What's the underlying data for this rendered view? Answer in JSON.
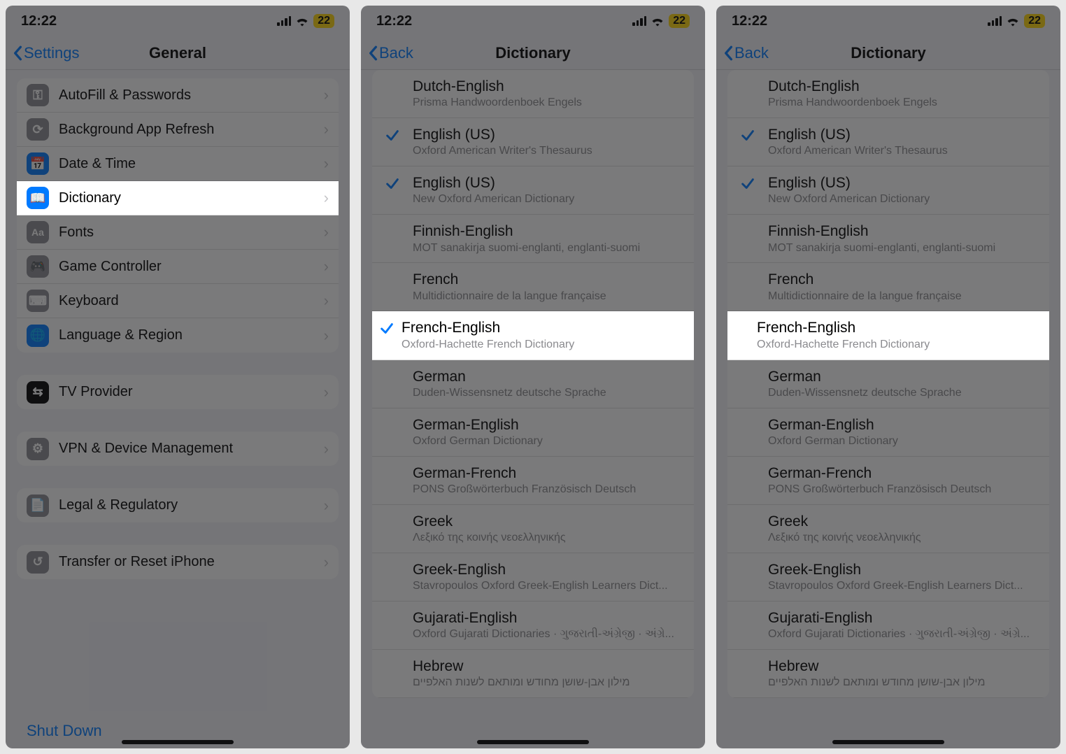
{
  "status": {
    "time": "12:22",
    "battery": "22"
  },
  "screen1": {
    "back_label": "Settings",
    "title": "General",
    "groups": [
      [
        {
          "label": "AutoFill & Passwords",
          "icon_bg": "#8e8e93",
          "glyph": "key-icon"
        },
        {
          "label": "Background App Refresh",
          "icon_bg": "#8e8e93",
          "glyph": "refresh-icon"
        },
        {
          "label": "Date & Time",
          "icon_bg": "#007aff",
          "glyph": "calendar-icon"
        },
        {
          "label": "Dictionary",
          "icon_bg": "#007aff",
          "glyph": "book-icon",
          "highlight": true
        },
        {
          "label": "Fonts",
          "icon_bg": "#8e8e93",
          "glyph": "font-icon"
        },
        {
          "label": "Game Controller",
          "icon_bg": "#8e8e93",
          "glyph": "gamepad-icon"
        },
        {
          "label": "Keyboard",
          "icon_bg": "#8e8e93",
          "glyph": "keyboard-icon"
        },
        {
          "label": "Language & Region",
          "icon_bg": "#007aff",
          "glyph": "globe-icon"
        }
      ],
      [
        {
          "label": "TV Provider",
          "icon_bg": "#000000",
          "glyph": "tv-icon"
        }
      ],
      [
        {
          "label": "VPN & Device Management",
          "icon_bg": "#8e8e93",
          "glyph": "gear-icon"
        }
      ],
      [
        {
          "label": "Legal & Regulatory",
          "icon_bg": "#8e8e93",
          "glyph": "document-icon"
        }
      ],
      [
        {
          "label": "Transfer or Reset iPhone",
          "icon_bg": "#8e8e93",
          "glyph": "reset-icon"
        }
      ]
    ],
    "shutdown_label": "Shut Down"
  },
  "dict_common": {
    "back_label": "Back",
    "title": "Dictionary",
    "items": [
      {
        "title": "Dutch-English",
        "sub": "Prisma Handwoordenboek Engels"
      },
      {
        "title": "English (US)",
        "sub": "Oxford American Writer's Thesaurus"
      },
      {
        "title": "English (US)",
        "sub": "New Oxford American Dictionary"
      },
      {
        "title": "Finnish-English",
        "sub": "MOT sanakirja suomi-englanti, englanti-suomi"
      },
      {
        "title": "French",
        "sub": "Multidictionnaire de la langue française"
      },
      {
        "title": "French-English",
        "sub": "Oxford-Hachette French Dictionary"
      },
      {
        "title": "German",
        "sub": "Duden-Wissensnetz deutsche Sprache"
      },
      {
        "title": "German-English",
        "sub": "Oxford German Dictionary"
      },
      {
        "title": "German-French",
        "sub": "PONS Großwörterbuch Französisch Deutsch"
      },
      {
        "title": "Greek",
        "sub": "Λεξικό της κοινής νεοελληνικής"
      },
      {
        "title": "Greek-English",
        "sub": "Stavropoulos Oxford Greek-English Learners Dict..."
      },
      {
        "title": "Gujarati-English",
        "sub": "Oxford Gujarati Dictionaries · ગુજરાતી-અંગ્રેજી · અંગ્રે..."
      },
      {
        "title": "Hebrew",
        "sub": "מילון אבן-שושן מחודש ומותאם לשנות האלפיים"
      }
    ]
  },
  "screen2": {
    "checked_indices": [
      1,
      2,
      5
    ],
    "highlight_index": 5
  },
  "screen3": {
    "checked_indices": [
      1,
      2
    ],
    "highlight_index": 5
  }
}
